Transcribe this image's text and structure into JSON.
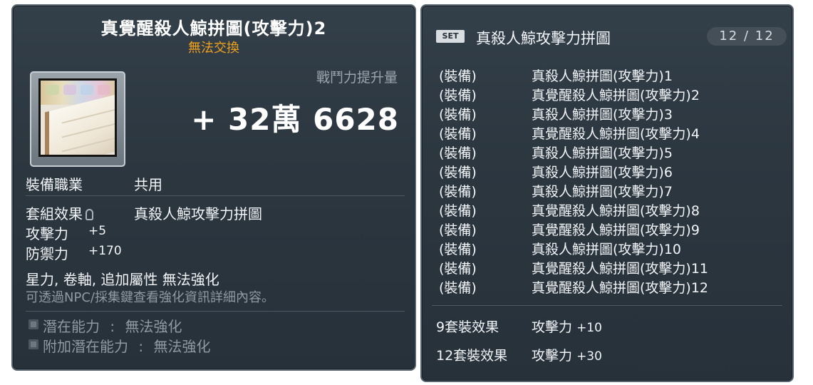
{
  "item": {
    "title": "真覺醒殺人鯨拼圖(攻擊力)2",
    "trade_status": "無法交換",
    "power_label": "戰鬥力提升量",
    "power_value": "+ 32萬 6628",
    "job_label": "裝備職業",
    "job_value": "共用",
    "set_label": "套組效果",
    "set_value": "真殺人鯨攻擊力拼圖",
    "stats": [
      {
        "label": "攻擊力",
        "value": "+5"
      },
      {
        "label": "防禦力",
        "value": "+170"
      }
    ],
    "enhance_note": "星力, 卷軸, 追加屬性 無法強化",
    "enhance_hint": "可透過NPC/採集鍵查看強化資訊詳細內容。",
    "potential": {
      "label": "潛在能力",
      "sep": ":",
      "value": "無法強化"
    },
    "bonus_potential": {
      "label": "附加潛在能力",
      "sep": ":",
      "value": "無法強化"
    }
  },
  "set_panel": {
    "badge": "SET",
    "title": "真殺人鯨攻擊力拼圖",
    "count": "12 / 12",
    "pieces": [
      {
        "tag": "(裝備)",
        "name": "真殺人鯨拼圖(攻擊力)1"
      },
      {
        "tag": "(裝備)",
        "name": "真覺醒殺人鯨拼圖(攻擊力)2"
      },
      {
        "tag": "(裝備)",
        "name": "真殺人鯨拼圖(攻擊力)3"
      },
      {
        "tag": "(裝備)",
        "name": "真覺醒殺人鯨拼圖(攻擊力)4"
      },
      {
        "tag": "(裝備)",
        "name": "真殺人鯨拼圖(攻擊力)5"
      },
      {
        "tag": "(裝備)",
        "name": "真殺人鯨拼圖(攻擊力)6"
      },
      {
        "tag": "(裝備)",
        "name": "真殺人鯨拼圖(攻擊力)7"
      },
      {
        "tag": "(裝備)",
        "name": "真覺醒殺人鯨拼圖(攻擊力)8"
      },
      {
        "tag": "(裝備)",
        "name": "真覺醒殺人鯨拼圖(攻擊力)9"
      },
      {
        "tag": "(裝備)",
        "name": "真殺人鯨拼圖(攻擊力)10"
      },
      {
        "tag": "(裝備)",
        "name": "真覺醒殺人鯨拼圖(攻擊力)11"
      },
      {
        "tag": "(裝備)",
        "name": "真覺醒殺人鯨拼圖(攻擊力)12"
      }
    ],
    "effects": [
      {
        "label": "9套裝效果",
        "stat": "攻擊力",
        "value": "+10"
      },
      {
        "label": "12套裝效果",
        "stat": "攻擊力",
        "value": "+30"
      }
    ]
  },
  "icons": {
    "item": "puzzle-item-icon",
    "lock": "lock-icon",
    "bullet": "potential-bullet-icon"
  },
  "colors": {
    "panel_bg": "#2c3740",
    "trade_status": "#f2a21d",
    "muted_text": "#8f9aa3"
  }
}
